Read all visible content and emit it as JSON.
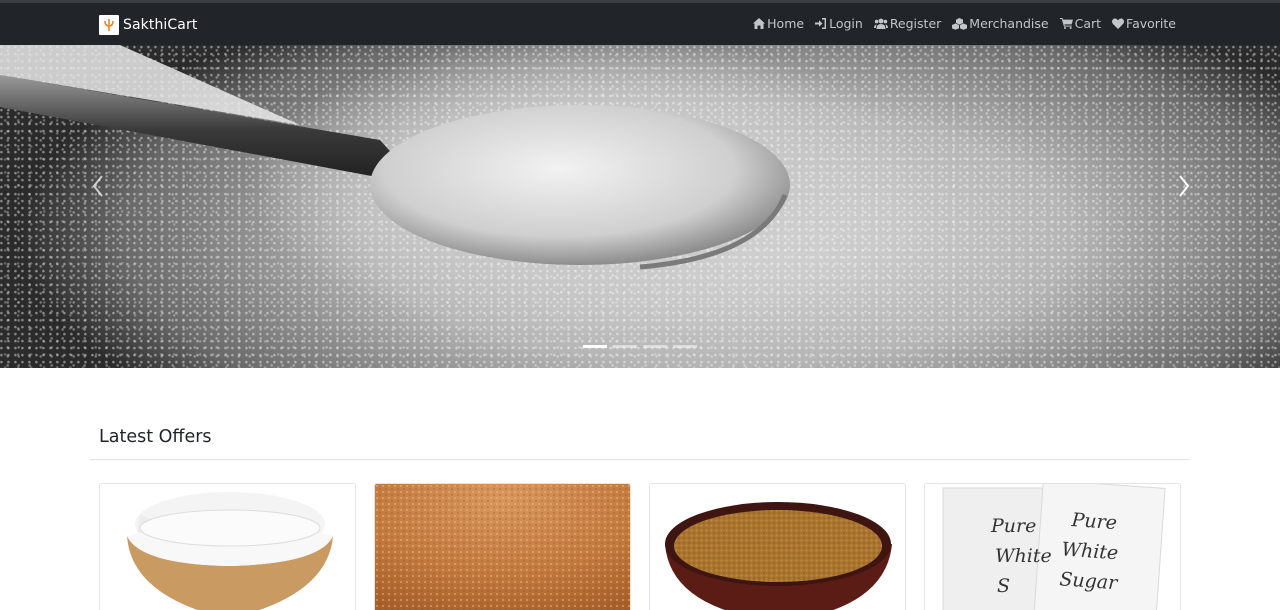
{
  "brand": {
    "name": "SakthiCart",
    "logo_icon": "trident-logo-icon",
    "logo_color": "#e58a2a"
  },
  "nav": {
    "items": [
      {
        "label": "Home",
        "icon": "home-icon"
      },
      {
        "label": "Login",
        "icon": "sign-in-icon"
      },
      {
        "label": "Register",
        "icon": "users-icon"
      },
      {
        "label": "Merchandise",
        "icon": "cubes-icon"
      },
      {
        "label": "Cart",
        "icon": "shopping-cart-icon"
      },
      {
        "label": "Favorite",
        "icon": "heart-icon"
      }
    ]
  },
  "carousel": {
    "slide_count": 4,
    "active_index": 0,
    "prev_icon": "chevron-left-icon",
    "next_icon": "chevron-right-icon"
  },
  "offers": {
    "title": "Latest Offers",
    "products": [
      {
        "image": "white-sugar-bowl"
      },
      {
        "image": "brown-sugar-crystals"
      },
      {
        "image": "brown-sugar-bowl"
      },
      {
        "image": "pure-white-sugar-sachets",
        "printed_text": [
          "Pure",
          "White",
          "Sugar"
        ]
      }
    ]
  },
  "colors": {
    "navbar_bg": "#212529",
    "nav_text": "#c2c5c9",
    "divider": "#dee2e6"
  }
}
